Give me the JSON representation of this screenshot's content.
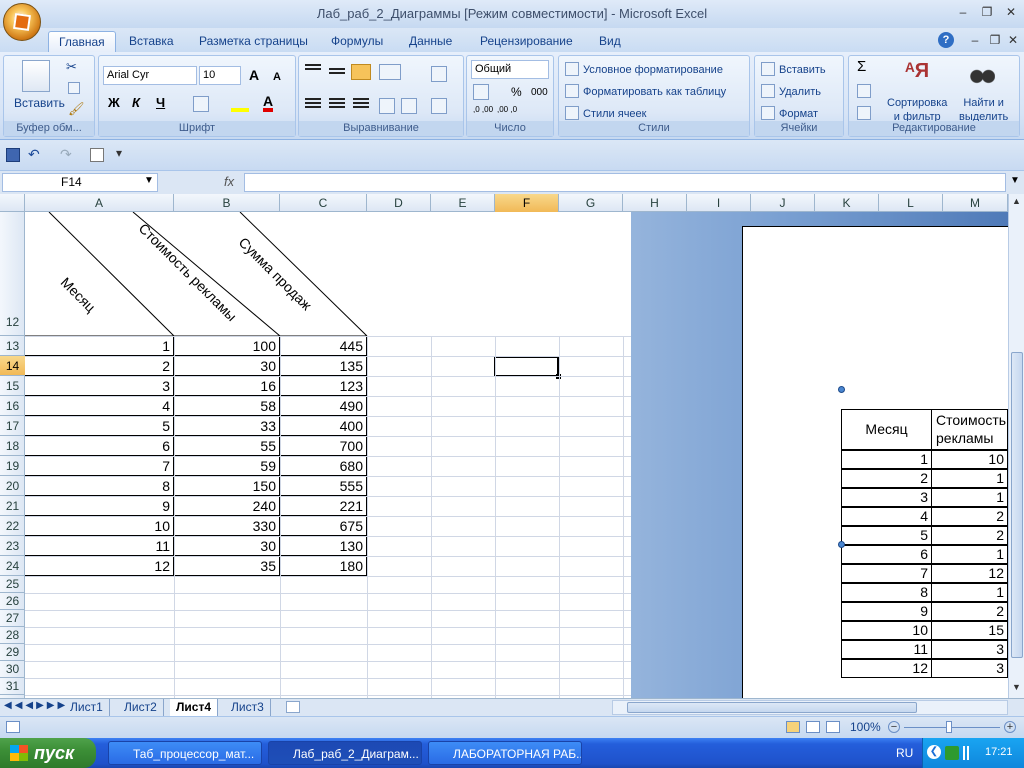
{
  "window": {
    "title": "Лаб_раб_2_Диаграммы  [Режим совместимости] - Microsoft Excel"
  },
  "ribbon_tabs": [
    "Главная",
    "Вставка",
    "Разметка страницы",
    "Формулы",
    "Данные",
    "Рецензирование",
    "Вид"
  ],
  "ribbon": {
    "clipboard": {
      "label": "Буфер обм...",
      "paste": "Вставить"
    },
    "font": {
      "label": "Шрифт",
      "name": "Arial Cyr",
      "size": "10",
      "bold": "Ж",
      "italic": "К",
      "underline": "Ч",
      "grow": "A",
      "shrink": "A",
      "color": "A"
    },
    "alignment": {
      "label": "Выравнивание"
    },
    "number": {
      "label": "Число",
      "format": "Общий",
      "percent": "%",
      "thousands": "000",
      "inc_decimal": ",0 ,00",
      "dec_decimal": ",00 ,0"
    },
    "styles": {
      "label": "Стили",
      "conditional": "Условное форматирование",
      "as_table": "Форматировать как таблицу",
      "cell_styles": "Стили ячеек"
    },
    "cells": {
      "label": "Ячейки",
      "insert": "Вставить",
      "delete": "Удалить",
      "format": "Формат"
    },
    "editing": {
      "label": "Редактирование",
      "sum": "Σ",
      "sort_l1": "Сортировка",
      "sort_l2": "и фильтр",
      "find_l1": "Найти и",
      "find_l2": "выделить"
    }
  },
  "formula_bar": {
    "name_box": "F14",
    "fx": "fx",
    "value": ""
  },
  "columns": [
    "A",
    "B",
    "C",
    "D",
    "E",
    "F",
    "G",
    "H",
    "I",
    "J",
    "K",
    "L",
    "M"
  ],
  "selected_column": "F",
  "selected_row": "14",
  "rows": [
    "12",
    "13",
    "14",
    "15",
    "16",
    "17",
    "18",
    "19",
    "20",
    "21",
    "22",
    "23",
    "24",
    "25",
    "26",
    "27",
    "28",
    "29",
    "30",
    "31"
  ],
  "headers": {
    "month": "Месяц",
    "ad_cost": "Стоимость рекламы",
    "sales": "Сумма продаж"
  },
  "table": [
    [
      "1",
      "100",
      "445"
    ],
    [
      "2",
      "30",
      "135"
    ],
    [
      "3",
      "16",
      "123"
    ],
    [
      "4",
      "58",
      "490"
    ],
    [
      "5",
      "33",
      "400"
    ],
    [
      "6",
      "55",
      "700"
    ],
    [
      "7",
      "59",
      "680"
    ],
    [
      "8",
      "150",
      "555"
    ],
    [
      "9",
      "240",
      "221"
    ],
    [
      "10",
      "330",
      "675"
    ],
    [
      "11",
      "30",
      "130"
    ],
    [
      "12",
      "35",
      "180"
    ]
  ],
  "chart_table": {
    "header_month": "Месяц",
    "header_cost_l1": "Стоимость",
    "header_cost_l2": "рекламы",
    "rows": [
      [
        "1",
        "10"
      ],
      [
        "2",
        "1"
      ],
      [
        "3",
        "1"
      ],
      [
        "4",
        "2"
      ],
      [
        "5",
        "2"
      ],
      [
        "6",
        "1"
      ],
      [
        "7",
        "12"
      ],
      [
        "8",
        "1"
      ],
      [
        "9",
        "2"
      ],
      [
        "10",
        "15"
      ],
      [
        "11",
        "3"
      ],
      [
        "12",
        "3"
      ]
    ]
  },
  "sheet_tabs": [
    "Лист1",
    "Лист2",
    "Лист4",
    "Лист3"
  ],
  "active_sheet": "Лист4",
  "status": {
    "zoom": "100%"
  },
  "taskbar": {
    "start": "пуск",
    "tasks": [
      "Таб_процессор_мат...",
      "Лаб_раб_2_Диаграм...",
      "ЛАБОРАТОРНАЯ РАБ..."
    ],
    "lang": "RU",
    "clock": "17:21"
  }
}
